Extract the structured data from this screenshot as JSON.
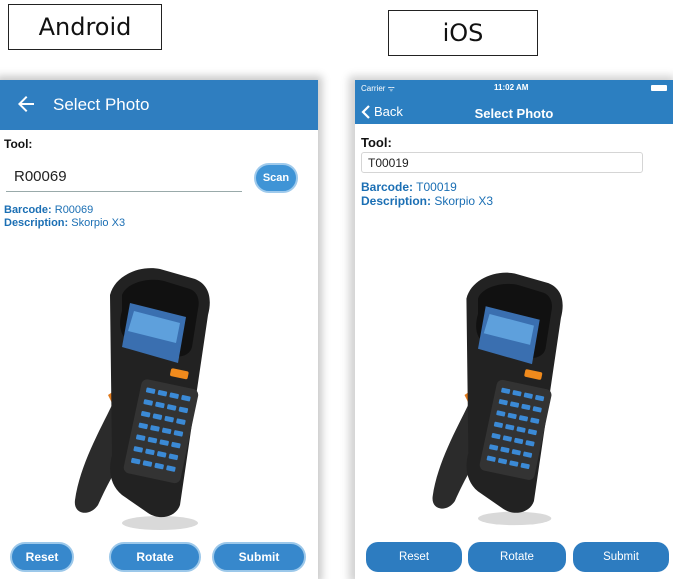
{
  "labels": {
    "android": "Android",
    "ios": "iOS"
  },
  "android": {
    "title": "Select Photo",
    "tool_label": "Tool:",
    "tool_value": "R00069",
    "scan_label": "Scan",
    "barcode_key": "Barcode:",
    "barcode_value": "R00069",
    "description_key": "Description:",
    "description_value": "Skorpio X3",
    "buttons": {
      "reset": "Reset",
      "rotate": "Rotate",
      "submit": "Submit"
    },
    "image": "handheld-scanner-photo"
  },
  "ios": {
    "status": {
      "carrier": "Carrier ᯤ",
      "time": "11:02 AM"
    },
    "back_label": "Back",
    "title": "Select Photo",
    "tool_label": "Tool:",
    "tool_value": "T00019",
    "barcode_key": "Barcode:",
    "barcode_value": "T00019",
    "description_key": "Description:",
    "description_value": "Skorpio X3",
    "buttons": {
      "reset": "Reset",
      "rotate": "Rotate",
      "submit": "Submit"
    },
    "image": "handheld-scanner-photo"
  },
  "colors": {
    "android_bar": "#2f7ec0",
    "ios_bar": "#2c7fc1",
    "accent_text": "#1b6fb4",
    "button": "#3788cc"
  }
}
